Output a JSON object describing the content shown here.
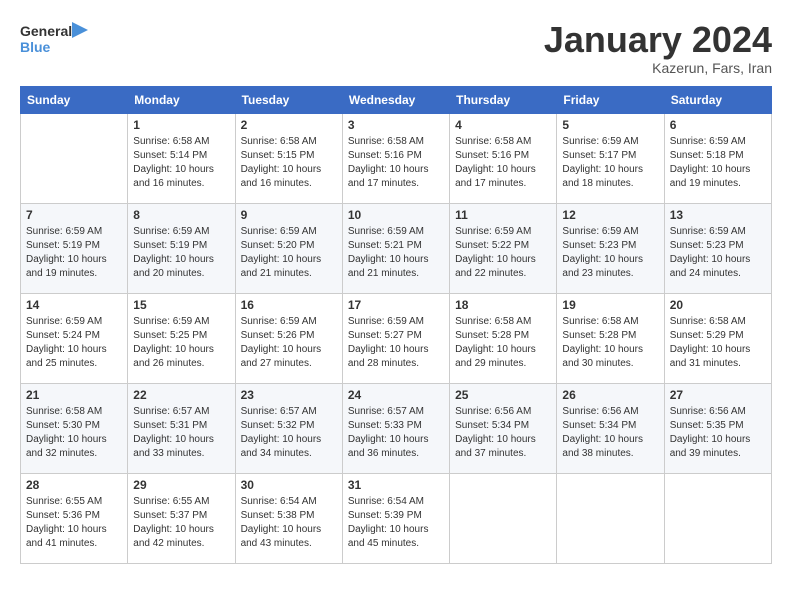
{
  "logo": {
    "text_general": "General",
    "text_blue": "Blue"
  },
  "header": {
    "title": "January 2024",
    "subtitle": "Kazerun, Fars, Iran"
  },
  "weekdays": [
    "Sunday",
    "Monday",
    "Tuesday",
    "Wednesday",
    "Thursday",
    "Friday",
    "Saturday"
  ],
  "weeks": [
    [
      {
        "day": "",
        "sunrise": "",
        "sunset": "",
        "daylight": ""
      },
      {
        "day": "1",
        "sunrise": "Sunrise: 6:58 AM",
        "sunset": "Sunset: 5:14 PM",
        "daylight": "Daylight: 10 hours and 16 minutes."
      },
      {
        "day": "2",
        "sunrise": "Sunrise: 6:58 AM",
        "sunset": "Sunset: 5:15 PM",
        "daylight": "Daylight: 10 hours and 16 minutes."
      },
      {
        "day": "3",
        "sunrise": "Sunrise: 6:58 AM",
        "sunset": "Sunset: 5:16 PM",
        "daylight": "Daylight: 10 hours and 17 minutes."
      },
      {
        "day": "4",
        "sunrise": "Sunrise: 6:58 AM",
        "sunset": "Sunset: 5:16 PM",
        "daylight": "Daylight: 10 hours and 17 minutes."
      },
      {
        "day": "5",
        "sunrise": "Sunrise: 6:59 AM",
        "sunset": "Sunset: 5:17 PM",
        "daylight": "Daylight: 10 hours and 18 minutes."
      },
      {
        "day": "6",
        "sunrise": "Sunrise: 6:59 AM",
        "sunset": "Sunset: 5:18 PM",
        "daylight": "Daylight: 10 hours and 19 minutes."
      }
    ],
    [
      {
        "day": "7",
        "sunrise": "Sunrise: 6:59 AM",
        "sunset": "Sunset: 5:19 PM",
        "daylight": "Daylight: 10 hours and 19 minutes."
      },
      {
        "day": "8",
        "sunrise": "Sunrise: 6:59 AM",
        "sunset": "Sunset: 5:19 PM",
        "daylight": "Daylight: 10 hours and 20 minutes."
      },
      {
        "day": "9",
        "sunrise": "Sunrise: 6:59 AM",
        "sunset": "Sunset: 5:20 PM",
        "daylight": "Daylight: 10 hours and 21 minutes."
      },
      {
        "day": "10",
        "sunrise": "Sunrise: 6:59 AM",
        "sunset": "Sunset: 5:21 PM",
        "daylight": "Daylight: 10 hours and 21 minutes."
      },
      {
        "day": "11",
        "sunrise": "Sunrise: 6:59 AM",
        "sunset": "Sunset: 5:22 PM",
        "daylight": "Daylight: 10 hours and 22 minutes."
      },
      {
        "day": "12",
        "sunrise": "Sunrise: 6:59 AM",
        "sunset": "Sunset: 5:23 PM",
        "daylight": "Daylight: 10 hours and 23 minutes."
      },
      {
        "day": "13",
        "sunrise": "Sunrise: 6:59 AM",
        "sunset": "Sunset: 5:23 PM",
        "daylight": "Daylight: 10 hours and 24 minutes."
      }
    ],
    [
      {
        "day": "14",
        "sunrise": "Sunrise: 6:59 AM",
        "sunset": "Sunset: 5:24 PM",
        "daylight": "Daylight: 10 hours and 25 minutes."
      },
      {
        "day": "15",
        "sunrise": "Sunrise: 6:59 AM",
        "sunset": "Sunset: 5:25 PM",
        "daylight": "Daylight: 10 hours and 26 minutes."
      },
      {
        "day": "16",
        "sunrise": "Sunrise: 6:59 AM",
        "sunset": "Sunset: 5:26 PM",
        "daylight": "Daylight: 10 hours and 27 minutes."
      },
      {
        "day": "17",
        "sunrise": "Sunrise: 6:59 AM",
        "sunset": "Sunset: 5:27 PM",
        "daylight": "Daylight: 10 hours and 28 minutes."
      },
      {
        "day": "18",
        "sunrise": "Sunrise: 6:58 AM",
        "sunset": "Sunset: 5:28 PM",
        "daylight": "Daylight: 10 hours and 29 minutes."
      },
      {
        "day": "19",
        "sunrise": "Sunrise: 6:58 AM",
        "sunset": "Sunset: 5:28 PM",
        "daylight": "Daylight: 10 hours and 30 minutes."
      },
      {
        "day": "20",
        "sunrise": "Sunrise: 6:58 AM",
        "sunset": "Sunset: 5:29 PM",
        "daylight": "Daylight: 10 hours and 31 minutes."
      }
    ],
    [
      {
        "day": "21",
        "sunrise": "Sunrise: 6:58 AM",
        "sunset": "Sunset: 5:30 PM",
        "daylight": "Daylight: 10 hours and 32 minutes."
      },
      {
        "day": "22",
        "sunrise": "Sunrise: 6:57 AM",
        "sunset": "Sunset: 5:31 PM",
        "daylight": "Daylight: 10 hours and 33 minutes."
      },
      {
        "day": "23",
        "sunrise": "Sunrise: 6:57 AM",
        "sunset": "Sunset: 5:32 PM",
        "daylight": "Daylight: 10 hours and 34 minutes."
      },
      {
        "day": "24",
        "sunrise": "Sunrise: 6:57 AM",
        "sunset": "Sunset: 5:33 PM",
        "daylight": "Daylight: 10 hours and 36 minutes."
      },
      {
        "day": "25",
        "sunrise": "Sunrise: 6:56 AM",
        "sunset": "Sunset: 5:34 PM",
        "daylight": "Daylight: 10 hours and 37 minutes."
      },
      {
        "day": "26",
        "sunrise": "Sunrise: 6:56 AM",
        "sunset": "Sunset: 5:34 PM",
        "daylight": "Daylight: 10 hours and 38 minutes."
      },
      {
        "day": "27",
        "sunrise": "Sunrise: 6:56 AM",
        "sunset": "Sunset: 5:35 PM",
        "daylight": "Daylight: 10 hours and 39 minutes."
      }
    ],
    [
      {
        "day": "28",
        "sunrise": "Sunrise: 6:55 AM",
        "sunset": "Sunset: 5:36 PM",
        "daylight": "Daylight: 10 hours and 41 minutes."
      },
      {
        "day": "29",
        "sunrise": "Sunrise: 6:55 AM",
        "sunset": "Sunset: 5:37 PM",
        "daylight": "Daylight: 10 hours and 42 minutes."
      },
      {
        "day": "30",
        "sunrise": "Sunrise: 6:54 AM",
        "sunset": "Sunset: 5:38 PM",
        "daylight": "Daylight: 10 hours and 43 minutes."
      },
      {
        "day": "31",
        "sunrise": "Sunrise: 6:54 AM",
        "sunset": "Sunset: 5:39 PM",
        "daylight": "Daylight: 10 hours and 45 minutes."
      },
      {
        "day": "",
        "sunrise": "",
        "sunset": "",
        "daylight": ""
      },
      {
        "day": "",
        "sunrise": "",
        "sunset": "",
        "daylight": ""
      },
      {
        "day": "",
        "sunrise": "",
        "sunset": "",
        "daylight": ""
      }
    ]
  ]
}
